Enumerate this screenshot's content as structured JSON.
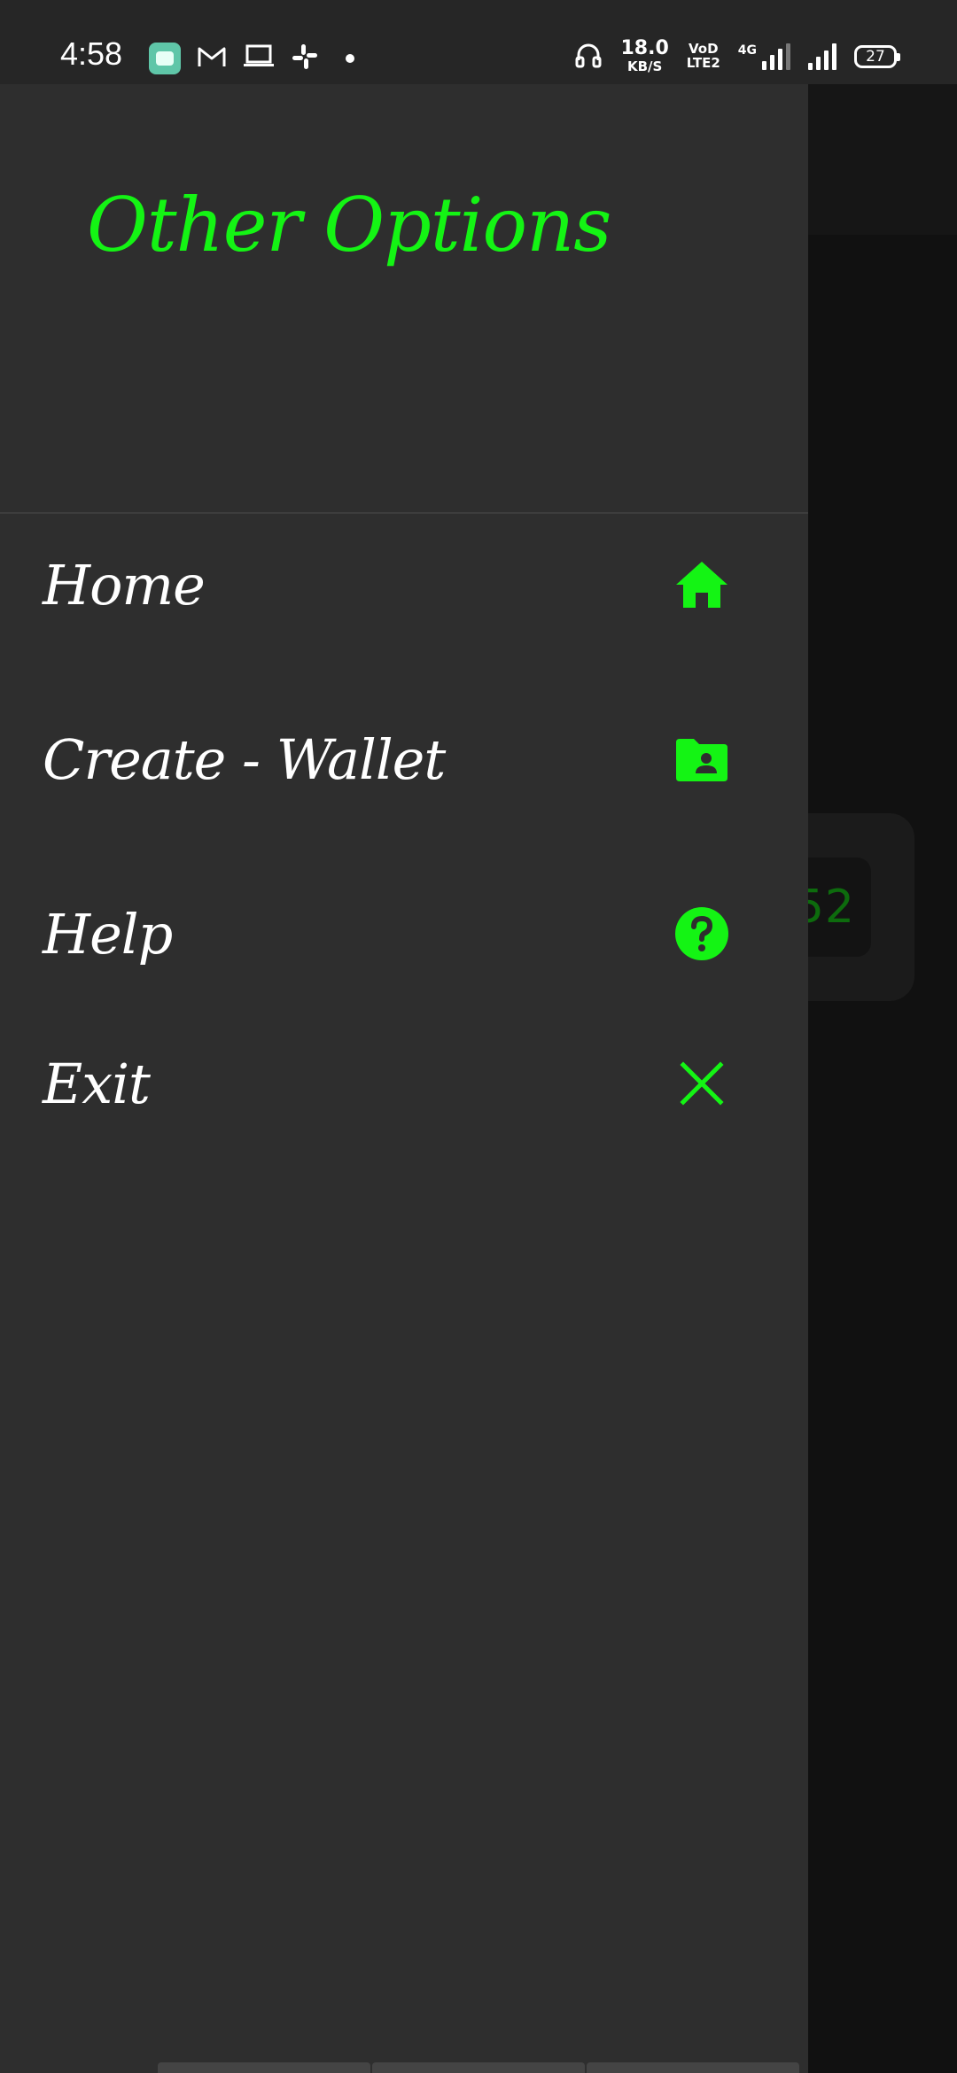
{
  "status_bar": {
    "time": "4:58",
    "net_speed_value": "18.0",
    "net_speed_unit": "KB/S",
    "volte_top": "VoD",
    "volte_bottom": "LTE2",
    "network_type": "4G",
    "battery_level": "27",
    "icons": [
      "app-notification-icon",
      "gmail-icon",
      "laptop-icon",
      "slack-icon",
      "headphones-icon"
    ]
  },
  "drawer": {
    "title": "Other Options",
    "title_color": "#14f414",
    "items": [
      {
        "label": "Home",
        "icon": "home-icon"
      },
      {
        "label": "Create - Wallet",
        "icon": "folder-user-icon"
      },
      {
        "label": "Help",
        "icon": "help-circle-icon"
      },
      {
        "label": "Exit",
        "icon": "close-icon"
      }
    ]
  },
  "background": {
    "card_number": "52"
  },
  "colors": {
    "accent": "#14f414",
    "drawer_bg": "#2e2e2e",
    "status_bar_bg": "#262626",
    "background": "#111111"
  }
}
